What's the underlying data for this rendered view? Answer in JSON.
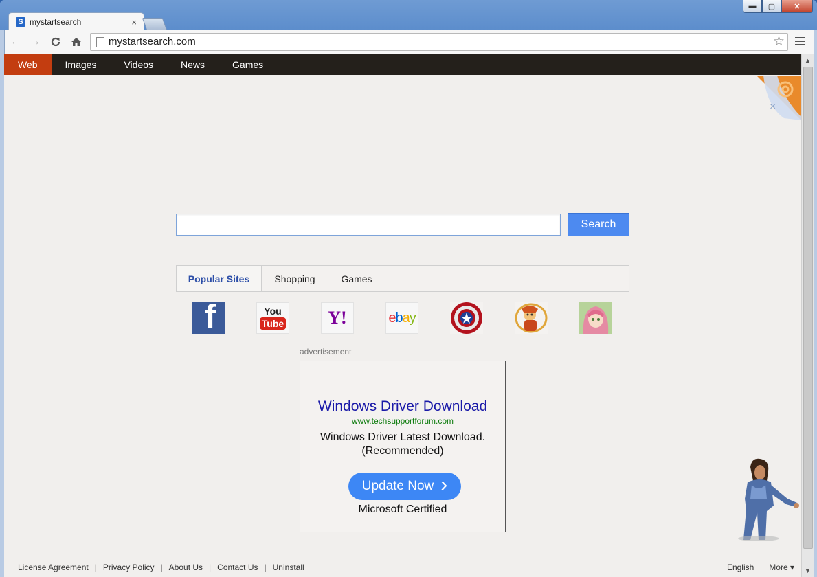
{
  "tab": {
    "title": "mystartsearch",
    "favicon_letter": "S",
    "close": "×"
  },
  "window_controls": {
    "minimize": "▬",
    "maximize": "▢",
    "close": "✕"
  },
  "toolbar": {
    "back": "←",
    "forward": "→",
    "reload": "C",
    "home": "⌂",
    "url": "mystartsearch.com",
    "star": "☆"
  },
  "topnav": {
    "items": [
      "Web",
      "Images",
      "Videos",
      "News",
      "Games"
    ],
    "active": "Web"
  },
  "search": {
    "value": "",
    "button_label": "Search"
  },
  "category_tabs": [
    "Popular Sites",
    "Shopping",
    "Games"
  ],
  "sites": [
    {
      "name": "facebook",
      "glyph": "f"
    },
    {
      "name": "youtube",
      "you": "You",
      "tube": "Tube"
    },
    {
      "name": "yahoo",
      "glyph": "Y!"
    },
    {
      "name": "ebay",
      "letters": [
        "e",
        "b",
        "a",
        "y"
      ]
    },
    {
      "name": "captain-america-game"
    },
    {
      "name": "fantasy-game-1"
    },
    {
      "name": "fantasy-game-2"
    }
  ],
  "ad": {
    "label": "advertisement",
    "title": "Windows Driver Download",
    "url": "www.techsupportforum.com",
    "desc_line1": "Windows Driver Latest Download.",
    "desc_line2": "(Recommended)",
    "button": "Update Now",
    "button_arrow": "›",
    "certified": "Microsoft Certified"
  },
  "footer": {
    "links": [
      "License Agreement",
      "Privacy Policy",
      "About Us",
      "Contact Us",
      "Uninstall"
    ],
    "separator": "|",
    "language": "English",
    "more": "More ▾"
  },
  "colors": {
    "nav_bg": "#24201b",
    "nav_active": "#c33d10",
    "search_btn": "#4d8af0",
    "ad_title": "#1a1aa8",
    "ad_url": "#0a7a0a"
  }
}
